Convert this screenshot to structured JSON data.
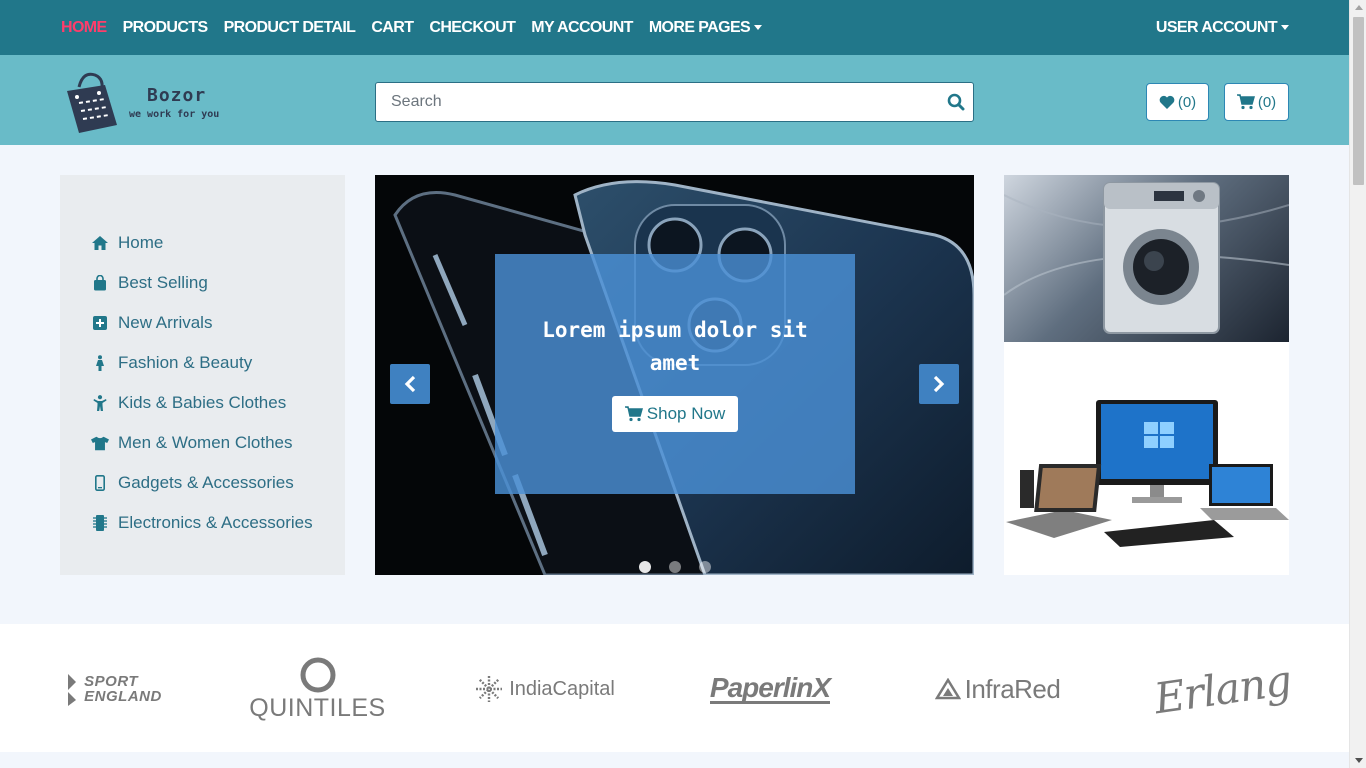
{
  "nav": {
    "items": [
      {
        "label": "HOME",
        "active": true
      },
      {
        "label": "PRODUCTS"
      },
      {
        "label": "PRODUCT DETAIL"
      },
      {
        "label": "CART"
      },
      {
        "label": "CHECKOUT"
      },
      {
        "label": "MY ACCOUNT"
      },
      {
        "label": "MORE PAGES",
        "dropdown": true
      }
    ],
    "account_label": "USER ACCOUNT"
  },
  "header": {
    "brand": "Bozor",
    "tagline": "we work for you",
    "search_placeholder": "Search",
    "wishlist_count": "(0)",
    "cart_count": "(0)"
  },
  "sidebar": {
    "items": [
      {
        "label": "Home",
        "icon": "home-icon"
      },
      {
        "label": "Best Selling",
        "icon": "shopping-bag-icon"
      },
      {
        "label": "New Arrivals",
        "icon": "plus-square-icon"
      },
      {
        "label": "Fashion & Beauty",
        "icon": "female-icon"
      },
      {
        "label": "Kids & Babies Clothes",
        "icon": "child-icon"
      },
      {
        "label": "Men & Women Clothes",
        "icon": "tshirt-icon"
      },
      {
        "label": "Gadgets & Accessories",
        "icon": "mobile-icon"
      },
      {
        "label": "Electronics & Accessories",
        "icon": "microchip-icon"
      }
    ]
  },
  "carousel": {
    "caption": "Lorem ipsum dolor sit amet",
    "cta": "Shop Now",
    "slides": 3,
    "active_slide": 1
  },
  "brands": {
    "items": [
      {
        "line1": "SPORT",
        "line2": "ENGLAND"
      },
      {
        "name": "QUINTILES"
      },
      {
        "name": "IndiaCapital"
      },
      {
        "name": "PaperlinX"
      },
      {
        "name": "InfraRed"
      },
      {
        "name": "Erlang"
      }
    ]
  },
  "colors": {
    "topbar": "#21778a",
    "header": "#69bbc8",
    "accent_active": "#ff3d6b",
    "link": "#2d6e85"
  }
}
